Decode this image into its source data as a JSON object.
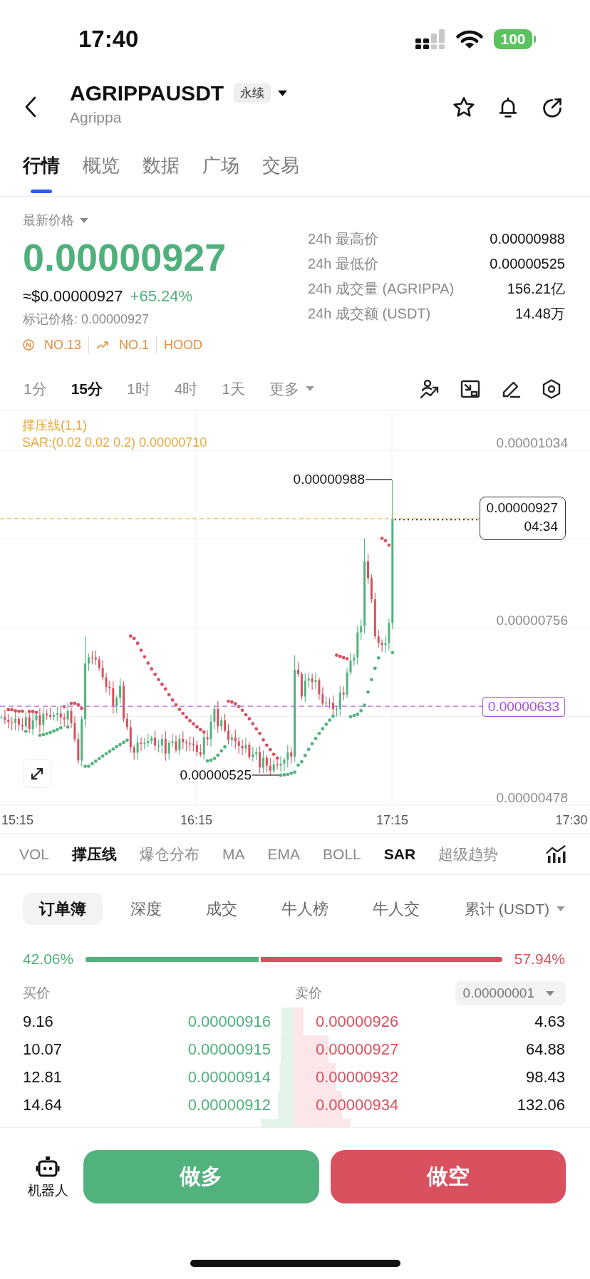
{
  "status_bar": {
    "time": "17:40",
    "battery": "100"
  },
  "header": {
    "symbol": "AGRIPPAUSDT",
    "badge": "永续",
    "name": "Agrippa"
  },
  "tabs": [
    {
      "label": "行情",
      "selected": true
    },
    {
      "label": "概览",
      "selected": false
    },
    {
      "label": "数据",
      "selected": false
    },
    {
      "label": "广场",
      "selected": false
    },
    {
      "label": "交易",
      "selected": false
    }
  ],
  "ticker": {
    "price_label": "最新价格",
    "last_price": "0.00000927",
    "usd_price": "≈$0.00000927",
    "change": "+65.24%",
    "mark_price": "标记价格: 0.00000927",
    "tags": [
      {
        "kind": "new",
        "label": "NO.13"
      },
      {
        "kind": "trending",
        "label": "NO.1"
      },
      {
        "kind": "plain",
        "label": "HOOD"
      }
    ],
    "stats": [
      {
        "label": "24h 最高价",
        "value": "0.00000988"
      },
      {
        "label": "24h 最低价",
        "value": "0.00000525"
      },
      {
        "label": "24h 成交量 (AGRIPPA)",
        "value": "156.21亿"
      },
      {
        "label": "24h 成交额 (USDT)",
        "value": "14.48万"
      }
    ]
  },
  "timeframes": [
    {
      "label": "1分",
      "kind": "option",
      "selected": false
    },
    {
      "label": "15分",
      "kind": "option",
      "selected": true
    },
    {
      "label": "1时",
      "kind": "option",
      "selected": false
    },
    {
      "label": "4时",
      "kind": "option",
      "selected": false
    },
    {
      "label": "1天",
      "kind": "option",
      "selected": false
    },
    {
      "label": "更多",
      "kind": "menu",
      "selected": false
    }
  ],
  "chart": {
    "legend": [
      "撑压线(1,1)",
      "SAR:(0.02 0.02 0.2) 0.00000710"
    ],
    "y_labels": [
      "0.00001034",
      "0.00000756",
      "0.00000478"
    ],
    "x_labels": [
      "15:15",
      "16:15",
      "17:15",
      "17:30"
    ],
    "high_label": "0.00000988",
    "low_label": "0.00000525",
    "last_price_tag": {
      "price": "0.00000927",
      "countdown": "04:34"
    },
    "level_tag": "0.00000633"
  },
  "indicators": [
    {
      "label": "VOL",
      "selected": false
    },
    {
      "label": "撑压线",
      "selected": true
    },
    {
      "label": "爆仓分布",
      "selected": false
    },
    {
      "label": "MA",
      "selected": false
    },
    {
      "label": "EMA",
      "selected": false
    },
    {
      "label": "BOLL",
      "selected": false
    },
    {
      "label": "SAR",
      "selected": true
    },
    {
      "label": "超级趋势",
      "selected": false
    }
  ],
  "order_book": {
    "tabs": [
      {
        "label": "订单簿",
        "selected": true
      },
      {
        "label": "深度",
        "selected": false
      },
      {
        "label": "成交",
        "selected": false
      },
      {
        "label": "牛人榜",
        "selected": false
      },
      {
        "label": "牛人交",
        "selected": false
      }
    ],
    "unit_menu": "累计 (USDT)",
    "ratio": {
      "buy": "42.06%",
      "sell": "57.94%",
      "level": 0.4206
    },
    "bid_header": "买价",
    "ask_header": "卖价",
    "precision": "0.00000001",
    "rows": [
      {
        "bid": {
          "total": "9.16",
          "price": "0.00000916"
        },
        "ask": {
          "price": "0.00000926",
          "total": "4.63"
        }
      },
      {
        "bid": {
          "total": "10.07",
          "price": "0.00000915"
        },
        "ask": {
          "price": "0.00000927",
          "total": "64.88"
        }
      },
      {
        "bid": {
          "total": "12.81",
          "price": "0.00000914"
        },
        "ask": {
          "price": "0.00000932",
          "total": "98.43"
        }
      },
      {
        "bid": {
          "total": "14.64",
          "price": "0.00000912"
        },
        "ask": {
          "price": "0.00000934",
          "total": "132.06"
        }
      }
    ]
  },
  "actions": {
    "bot": "机器人",
    "buttons": [
      {
        "kind": "long",
        "label": "做多"
      },
      {
        "kind": "short",
        "label": "做空"
      }
    ]
  }
}
